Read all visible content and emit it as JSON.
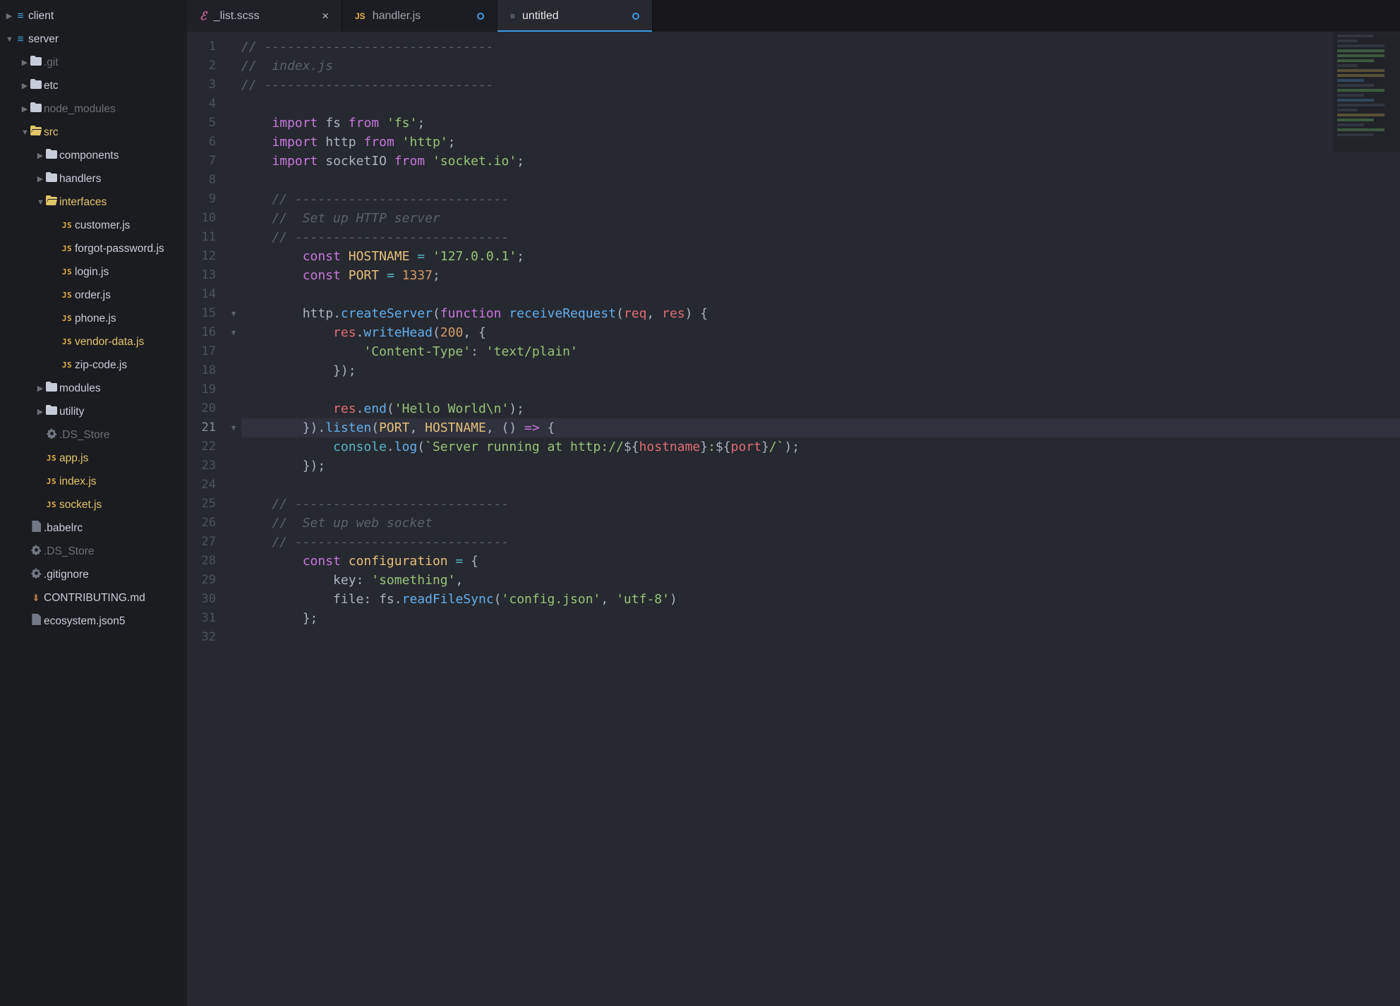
{
  "tree": [
    {
      "depth": 0,
      "arrow": "right",
      "icon": "hash",
      "style": "normal",
      "label": "client"
    },
    {
      "depth": 0,
      "arrow": "down",
      "icon": "hash",
      "style": "normal",
      "label": "server"
    },
    {
      "depth": 1,
      "arrow": "right",
      "icon": "folder",
      "style": "muted",
      "label": ".git"
    },
    {
      "depth": 1,
      "arrow": "right",
      "icon": "folder",
      "style": "normal",
      "label": "etc"
    },
    {
      "depth": 1,
      "arrow": "right",
      "icon": "folder",
      "style": "muted",
      "label": "node_modules"
    },
    {
      "depth": 1,
      "arrow": "down",
      "icon": "folder-open",
      "style": "active",
      "label": "src"
    },
    {
      "depth": 2,
      "arrow": "right",
      "icon": "folder",
      "style": "normal",
      "label": "components"
    },
    {
      "depth": 2,
      "arrow": "right",
      "icon": "folder",
      "style": "normal",
      "label": "handlers"
    },
    {
      "depth": 2,
      "arrow": "down",
      "icon": "folder-open",
      "style": "active",
      "label": "interfaces"
    },
    {
      "depth": 3,
      "arrow": "",
      "icon": "js",
      "style": "normal",
      "label": "customer.js"
    },
    {
      "depth": 3,
      "arrow": "",
      "icon": "js",
      "style": "normal",
      "label": "forgot-password.js"
    },
    {
      "depth": 3,
      "arrow": "",
      "icon": "js",
      "style": "normal",
      "label": "login.js"
    },
    {
      "depth": 3,
      "arrow": "",
      "icon": "js",
      "style": "normal",
      "label": "order.js"
    },
    {
      "depth": 3,
      "arrow": "",
      "icon": "js",
      "style": "normal",
      "label": "phone.js"
    },
    {
      "depth": 3,
      "arrow": "",
      "icon": "js",
      "style": "active",
      "label": "vendor-data.js"
    },
    {
      "depth": 3,
      "arrow": "",
      "icon": "js",
      "style": "normal",
      "label": "zip-code.js"
    },
    {
      "depth": 2,
      "arrow": "right",
      "icon": "folder",
      "style": "normal",
      "label": "modules"
    },
    {
      "depth": 2,
      "arrow": "right",
      "icon": "folder",
      "style": "normal",
      "label": "utility"
    },
    {
      "depth": 2,
      "arrow": "",
      "icon": "gear",
      "style": "muted",
      "label": ".DS_Store"
    },
    {
      "depth": 2,
      "arrow": "",
      "icon": "js",
      "style": "active",
      "label": "app.js"
    },
    {
      "depth": 2,
      "arrow": "",
      "icon": "js",
      "style": "active",
      "label": "index.js"
    },
    {
      "depth": 2,
      "arrow": "",
      "icon": "js",
      "style": "active",
      "label": "socket.js"
    },
    {
      "depth": 1,
      "arrow": "",
      "icon": "file",
      "style": "normal",
      "label": ".babelrc"
    },
    {
      "depth": 1,
      "arrow": "",
      "icon": "gear",
      "style": "muted",
      "label": ".DS_Store"
    },
    {
      "depth": 1,
      "arrow": "",
      "icon": "gear",
      "style": "normal",
      "label": ".gitignore"
    },
    {
      "depth": 1,
      "arrow": "",
      "icon": "down",
      "style": "normal",
      "label": "CONTRIBUTING.md"
    },
    {
      "depth": 1,
      "arrow": "",
      "icon": "file",
      "style": "normal",
      "label": "ecosystem.json5"
    }
  ],
  "tabs": [
    {
      "icon": "sass",
      "label": "_list.scss",
      "tail": "close",
      "state": "dim"
    },
    {
      "icon": "js",
      "label": "handler.js",
      "tail": "dirty",
      "state": "dimmer"
    },
    {
      "icon": "file",
      "label": "untitled",
      "tail": "dirty",
      "state": "active"
    }
  ],
  "editor": {
    "line_count": 32,
    "active_line": 21,
    "foldable_lines": [
      15,
      16,
      21
    ],
    "lines": [
      [
        [
          "c",
          "// ------------------------------"
        ]
      ],
      [
        [
          "c",
          "//  index.js"
        ]
      ],
      [
        [
          "c",
          "// ------------------------------"
        ]
      ],
      [],
      [
        [
          "sp",
          "    "
        ],
        [
          "kw",
          "import"
        ],
        [
          "p",
          " "
        ],
        [
          "id",
          "fs"
        ],
        [
          "p",
          " "
        ],
        [
          "kw",
          "from"
        ],
        [
          "p",
          " "
        ],
        [
          "str",
          "'fs'"
        ],
        [
          "p",
          ";"
        ]
      ],
      [
        [
          "sp",
          "    "
        ],
        [
          "kw",
          "import"
        ],
        [
          "p",
          " "
        ],
        [
          "id",
          "http"
        ],
        [
          "p",
          " "
        ],
        [
          "kw",
          "from"
        ],
        [
          "p",
          " "
        ],
        [
          "str",
          "'http'"
        ],
        [
          "p",
          ";"
        ]
      ],
      [
        [
          "sp",
          "    "
        ],
        [
          "kw",
          "import"
        ],
        [
          "p",
          " "
        ],
        [
          "id",
          "socketIO"
        ],
        [
          "p",
          " "
        ],
        [
          "kw",
          "from"
        ],
        [
          "p",
          " "
        ],
        [
          "str",
          "'socket.io'"
        ],
        [
          "p",
          ";"
        ]
      ],
      [],
      [
        [
          "sp",
          "    "
        ],
        [
          "c",
          "// ----------------------------"
        ]
      ],
      [
        [
          "sp",
          "    "
        ],
        [
          "c",
          "//  Set up HTTP server"
        ]
      ],
      [
        [
          "sp",
          "    "
        ],
        [
          "c",
          "// ----------------------------"
        ]
      ],
      [
        [
          "sp",
          "        "
        ],
        [
          "kw",
          "const"
        ],
        [
          "p",
          " "
        ],
        [
          "con",
          "HOSTNAME"
        ],
        [
          "p",
          " "
        ],
        [
          "op",
          "="
        ],
        [
          "p",
          " "
        ],
        [
          "str",
          "'127.0.0.1'"
        ],
        [
          "p",
          ";"
        ]
      ],
      [
        [
          "sp",
          "        "
        ],
        [
          "kw",
          "const"
        ],
        [
          "p",
          " "
        ],
        [
          "con",
          "PORT"
        ],
        [
          "p",
          " "
        ],
        [
          "op",
          "="
        ],
        [
          "p",
          " "
        ],
        [
          "num",
          "1337"
        ],
        [
          "p",
          ";"
        ]
      ],
      [],
      [
        [
          "sp",
          "        "
        ],
        [
          "id",
          "http"
        ],
        [
          "p",
          "."
        ],
        [
          "fnc",
          "createServer"
        ],
        [
          "p",
          "("
        ],
        [
          "kw",
          "function"
        ],
        [
          "p",
          " "
        ],
        [
          "fnc",
          "receiveRequest"
        ],
        [
          "p",
          "("
        ],
        [
          "pr",
          "req"
        ],
        [
          "p",
          ", "
        ],
        [
          "pr",
          "res"
        ],
        [
          "p",
          ") {"
        ]
      ],
      [
        [
          "sp",
          "            "
        ],
        [
          "pr",
          "res"
        ],
        [
          "p",
          "."
        ],
        [
          "fnc",
          "writeHead"
        ],
        [
          "p",
          "("
        ],
        [
          "num",
          "200"
        ],
        [
          "p",
          ", {"
        ]
      ],
      [
        [
          "sp",
          "                "
        ],
        [
          "str",
          "'Content-Type'"
        ],
        [
          "p",
          ": "
        ],
        [
          "str",
          "'text/plain'"
        ]
      ],
      [
        [
          "sp",
          "            "
        ],
        [
          "p",
          "});"
        ]
      ],
      [],
      [
        [
          "sp",
          "            "
        ],
        [
          "pr",
          "res"
        ],
        [
          "p",
          "."
        ],
        [
          "fnc",
          "end"
        ],
        [
          "p",
          "("
        ],
        [
          "str",
          "'Hello World\\n'"
        ],
        [
          "p",
          ");"
        ]
      ],
      [
        [
          "sp",
          "        "
        ],
        [
          "p",
          "})."
        ],
        [
          "fnc",
          "listen"
        ],
        [
          "p",
          "("
        ],
        [
          "con",
          "PORT"
        ],
        [
          "p",
          ", "
        ],
        [
          "con",
          "HOSTNAME"
        ],
        [
          "p",
          ", () "
        ],
        [
          "kw",
          "=>"
        ],
        [
          "p",
          " {"
        ]
      ],
      [
        [
          "sp",
          "            "
        ],
        [
          "fn",
          "console"
        ],
        [
          "p",
          "."
        ],
        [
          "fnc",
          "log"
        ],
        [
          "p",
          "("
        ],
        [
          "str",
          "`Server running at http://"
        ],
        [
          "p",
          "${"
        ],
        [
          "tmpl",
          "hostname"
        ],
        [
          "p",
          "}"
        ],
        [
          "str",
          ":"
        ],
        [
          "p",
          "${"
        ],
        [
          "tmpl",
          "port"
        ],
        [
          "p",
          "}"
        ],
        [
          "str",
          "/`"
        ],
        [
          "p",
          ");"
        ]
      ],
      [
        [
          "sp",
          "        "
        ],
        [
          "p",
          "});"
        ]
      ],
      [],
      [
        [
          "sp",
          "    "
        ],
        [
          "c",
          "// ----------------------------"
        ]
      ],
      [
        [
          "sp",
          "    "
        ],
        [
          "c",
          "//  Set up web socket"
        ]
      ],
      [
        [
          "sp",
          "    "
        ],
        [
          "c",
          "// ----------------------------"
        ]
      ],
      [
        [
          "sp",
          "        "
        ],
        [
          "kw",
          "const"
        ],
        [
          "p",
          " "
        ],
        [
          "con",
          "configuration"
        ],
        [
          "p",
          " "
        ],
        [
          "op",
          "="
        ],
        [
          "p",
          " {"
        ]
      ],
      [
        [
          "sp",
          "            "
        ],
        [
          "id",
          "key"
        ],
        [
          "p",
          ": "
        ],
        [
          "str",
          "'something'"
        ],
        [
          "p",
          ","
        ]
      ],
      [
        [
          "sp",
          "            "
        ],
        [
          "id",
          "file"
        ],
        [
          "p",
          ": "
        ],
        [
          "id",
          "fs"
        ],
        [
          "p",
          "."
        ],
        [
          "fnc",
          "readFileSync"
        ],
        [
          "p",
          "("
        ],
        [
          "str",
          "'config.json'"
        ],
        [
          "p",
          ", "
        ],
        [
          "str",
          "'utf-8'"
        ],
        [
          "p",
          ")"
        ]
      ],
      [
        [
          "sp",
          "        "
        ],
        [
          "p",
          "};"
        ]
      ],
      []
    ]
  }
}
